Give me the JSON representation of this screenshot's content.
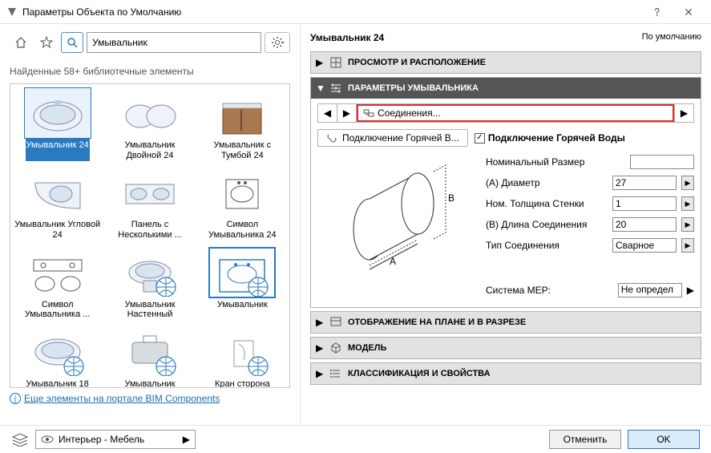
{
  "window": {
    "title": "Параметры Объекта по Умолчанию"
  },
  "search": {
    "value": "Умывальник"
  },
  "found_label": "Найденные 58+ библиотечные элементы",
  "library": [
    {
      "label": "Умывальник 24",
      "selected": true,
      "kind": "basin-oval"
    },
    {
      "label": "Умывальник Двойной 24",
      "kind": "basin-double"
    },
    {
      "label": "Умывальник с Тумбой 24",
      "kind": "basin-cabinet"
    },
    {
      "label": "Умывальник Угловой 24",
      "kind": "basin-corner"
    },
    {
      "label": "Панель с Несколькими ...",
      "kind": "basin-panel"
    },
    {
      "label": "Символ Умывальника 24",
      "kind": "basin-symbol"
    },
    {
      "label": "Символ Умывальника ...",
      "kind": "basin-symbol2"
    },
    {
      "label": "Умывальник Настенный",
      "kind": "basin-wall"
    },
    {
      "label": "Умывальник",
      "kind": "basin-globe",
      "highlighted": true
    },
    {
      "label": "Умывальник 18",
      "kind": "basin-18"
    },
    {
      "label": "Умывальник хирургически...",
      "kind": "basin-surgical"
    },
    {
      "label": "Кран сторона",
      "kind": "tap-side"
    }
  ],
  "bim_link": "Еще элементы на портале BIM Components",
  "right": {
    "name": "Умывальник 24",
    "default": "По умолчанию",
    "panels": {
      "view": "ПРОСМОТР И РАСПОЛОЖЕНИЕ",
      "params": "ПАРАМЕТРЫ УМЫВАЛЬНИКА",
      "connections": {
        "nav_label": "Соединения...",
        "hot_tab": "Подключение Горячей В...",
        "hot_check": "Подключение Горячей Воды",
        "rows": [
          {
            "label": "Номинальный Размер",
            "value": "",
            "arrow": false
          },
          {
            "label": "(A) Диаметр",
            "value": "27",
            "arrow": true
          },
          {
            "label": "Ном. Толщина Стенки",
            "value": "1",
            "arrow": true
          },
          {
            "label": "(B) Длина Соединения",
            "value": "20",
            "arrow": true
          },
          {
            "label": "Тип Соединения",
            "value": "Сварное",
            "arrow": true
          }
        ],
        "mep_label": "Система MEP:",
        "mep_value": "Не определ"
      },
      "plan": "ОТОБРАЖЕНИЕ НА ПЛАНЕ И В РАЗРЕЗЕ",
      "model": "МОДЕЛЬ",
      "classif": "КЛАССИФИКАЦИЯ И СВОЙСТВА"
    }
  },
  "footer": {
    "layer": "Интерьер - Мебель",
    "cancel": "Отменить",
    "ok": "OK"
  }
}
